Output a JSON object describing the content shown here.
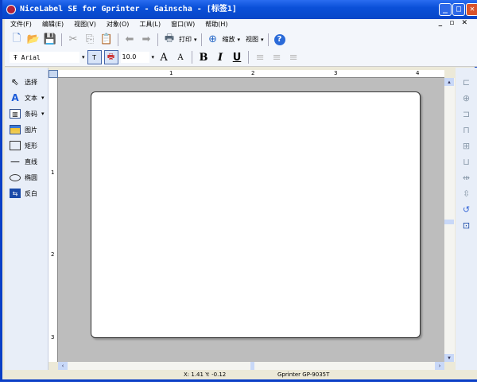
{
  "window": {
    "title": "NiceLabel SE for Gprinter - Gainscha - [标签1]"
  },
  "menu": [
    "文件(F)",
    "编辑(E)",
    "视图(V)",
    "对象(O)",
    "工具(L)",
    "窗口(W)",
    "帮助(H)"
  ],
  "toolbar": {
    "print_label": "打印",
    "zoom_label": "缩放",
    "view_label": "视图"
  },
  "format": {
    "font": "Arial",
    "size": "10.0",
    "bold": "B",
    "italic": "I",
    "underline": "U"
  },
  "tools": [
    {
      "label": "选择",
      "icon": "cursor-icon"
    },
    {
      "label": "文本",
      "icon": "text-icon"
    },
    {
      "label": "条码",
      "icon": "barcode-icon"
    },
    {
      "label": "图片",
      "icon": "image-icon"
    },
    {
      "label": "矩形",
      "icon": "rectangle-icon"
    },
    {
      "label": "直线",
      "icon": "line-icon"
    },
    {
      "label": "椭圆",
      "icon": "ellipse-icon"
    },
    {
      "label": "反白",
      "icon": "inverse-icon"
    }
  ],
  "ruler": {
    "h": [
      "1",
      "2",
      "3",
      "4"
    ],
    "v": [
      "1",
      "2",
      "3"
    ]
  },
  "status": {
    "coords": "X: 1.41 Y: -0.12",
    "printer": "Gprinter GP-9035T"
  }
}
